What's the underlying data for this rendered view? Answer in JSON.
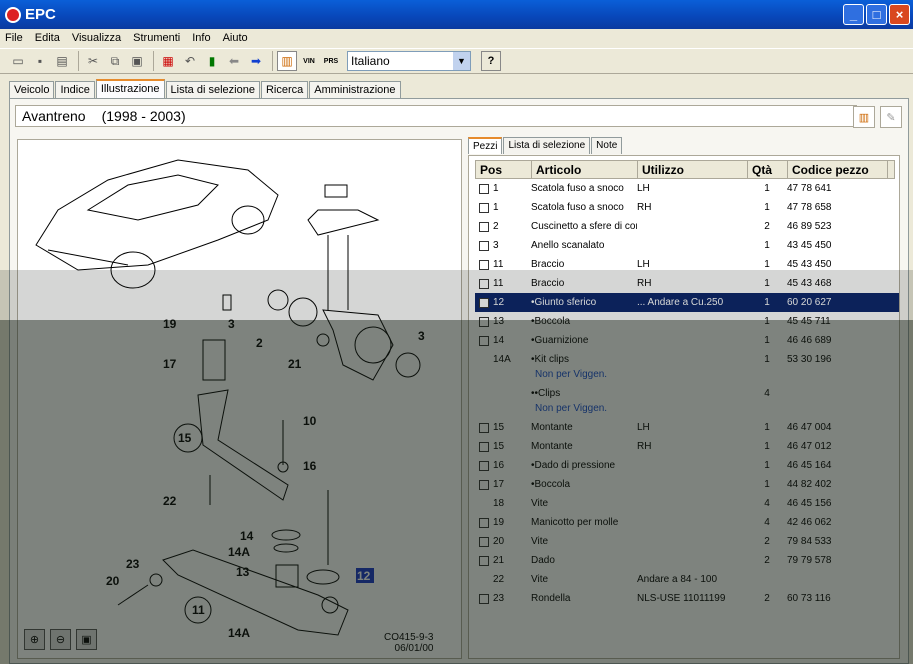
{
  "window": {
    "title": "EPC",
    "min_icon": "minimize-icon",
    "max_icon": "maximize-icon",
    "close_icon": "close-icon"
  },
  "menu": [
    "File",
    "Edita",
    "Visualizza",
    "Strumenti",
    "Info",
    "Aiuto"
  ],
  "toolbar": {
    "language": "Italiano",
    "vin": "VIN",
    "prs": "PRS",
    "help": "?"
  },
  "tabs": [
    "Veicolo",
    "Indice",
    "Illustrazione",
    "Lista di selezione",
    "Ricerca",
    "Amministrazione"
  ],
  "header": {
    "title": "Avantreno",
    "years": "(1998 - 2003)"
  },
  "illustration": {
    "code_line1": "CO415-9-3",
    "code_line2": "06/01/00",
    "labels": [
      "19",
      "3",
      "2",
      "3",
      "17",
      "21",
      "10",
      "15",
      "16",
      "22",
      "14",
      "14A",
      "13",
      "12",
      "23",
      "20",
      "11",
      "14A"
    ]
  },
  "parts_tabs": [
    "Pezzi",
    "Lista di selezione",
    "Note"
  ],
  "parts_columns": [
    "Pos",
    "Articolo",
    "Utilizzo",
    "Qtà",
    "Codice pezzo"
  ],
  "parts_rows": [
    {
      "pos": "1",
      "art": "Scatola fuso a snoco",
      "uti": "LH",
      "qta": "1",
      "cod": "47 78 641",
      "checkbox": true
    },
    {
      "pos": "1",
      "art": "Scatola fuso a snoco",
      "uti": "RH",
      "qta": "1",
      "cod": "47 78 658",
      "checkbox": true
    },
    {
      "pos": "2",
      "art": "Cuscinetto a sfere di contatto angolare",
      "uti": "",
      "qta": "2",
      "cod": "46 89 523",
      "checkbox": true
    },
    {
      "pos": "3",
      "art": "Anello scanalato",
      "uti": "",
      "qta": "1",
      "cod": "43 45 450",
      "checkbox": true
    },
    {
      "pos": "11",
      "art": "Braccio",
      "uti": "LH",
      "qta": "1",
      "cod": "45 43 450",
      "checkbox": true
    },
    {
      "pos": "11",
      "art": "Braccio",
      "uti": "RH",
      "qta": "1",
      "cod": "45 43 468",
      "checkbox": true
    },
    {
      "pos": "12",
      "art": "•Giunto sferico",
      "uti": "... Andare a Cu.250",
      "qta": "1",
      "cod": "60 20 627",
      "checkbox": true,
      "selected": true
    },
    {
      "pos": "13",
      "art": "•Boccola",
      "uti": "",
      "qta": "1",
      "cod": "45 45 711",
      "checkbox": true
    },
    {
      "pos": "14",
      "art": "•Guarnizione",
      "uti": "",
      "qta": "1",
      "cod": "46 46 689",
      "checkbox": true
    },
    {
      "pos": "14A",
      "art": "•Kit clips",
      "uti": "",
      "qta": "1",
      "cod": "53 30 196",
      "checkbox": false,
      "note": "Non per Viggen."
    },
    {
      "pos": "",
      "art": "••Clips",
      "uti": "",
      "qta": "4",
      "cod": "",
      "checkbox": false,
      "note": "Non per Viggen."
    },
    {
      "pos": "15",
      "art": "Montante",
      "uti": "LH",
      "qta": "1",
      "cod": "46 47 004",
      "checkbox": true
    },
    {
      "pos": "15",
      "art": "Montante",
      "uti": "RH",
      "qta": "1",
      "cod": "46 47 012",
      "checkbox": true
    },
    {
      "pos": "16",
      "art": "•Dado di pressione",
      "uti": "",
      "qta": "1",
      "cod": "46 45 164",
      "checkbox": true
    },
    {
      "pos": "17",
      "art": "•Boccola",
      "uti": "",
      "qta": "1",
      "cod": "44 82 402",
      "checkbox": true
    },
    {
      "pos": "18",
      "art": "Vite",
      "uti": "",
      "qta": "4",
      "cod": "46 45 156",
      "checkbox": false
    },
    {
      "pos": "19",
      "art": "Manicotto per molle",
      "uti": "",
      "qta": "4",
      "cod": "42 46 062",
      "checkbox": true
    },
    {
      "pos": "20",
      "art": "Vite",
      "uti": "",
      "qta": "2",
      "cod": "79 84 533",
      "checkbox": true
    },
    {
      "pos": "21",
      "art": "Dado",
      "uti": "",
      "qta": "2",
      "cod": "79 79 578",
      "checkbox": true
    },
    {
      "pos": "22",
      "art": "Vite",
      "uti": "Andare a 84 - 100",
      "qta": "",
      "cod": "",
      "checkbox": false
    },
    {
      "pos": "23",
      "art": "Rondella",
      "uti": "NLS-USE 11011199",
      "qta": "2",
      "cod": "60 73 116",
      "checkbox": true
    }
  ]
}
